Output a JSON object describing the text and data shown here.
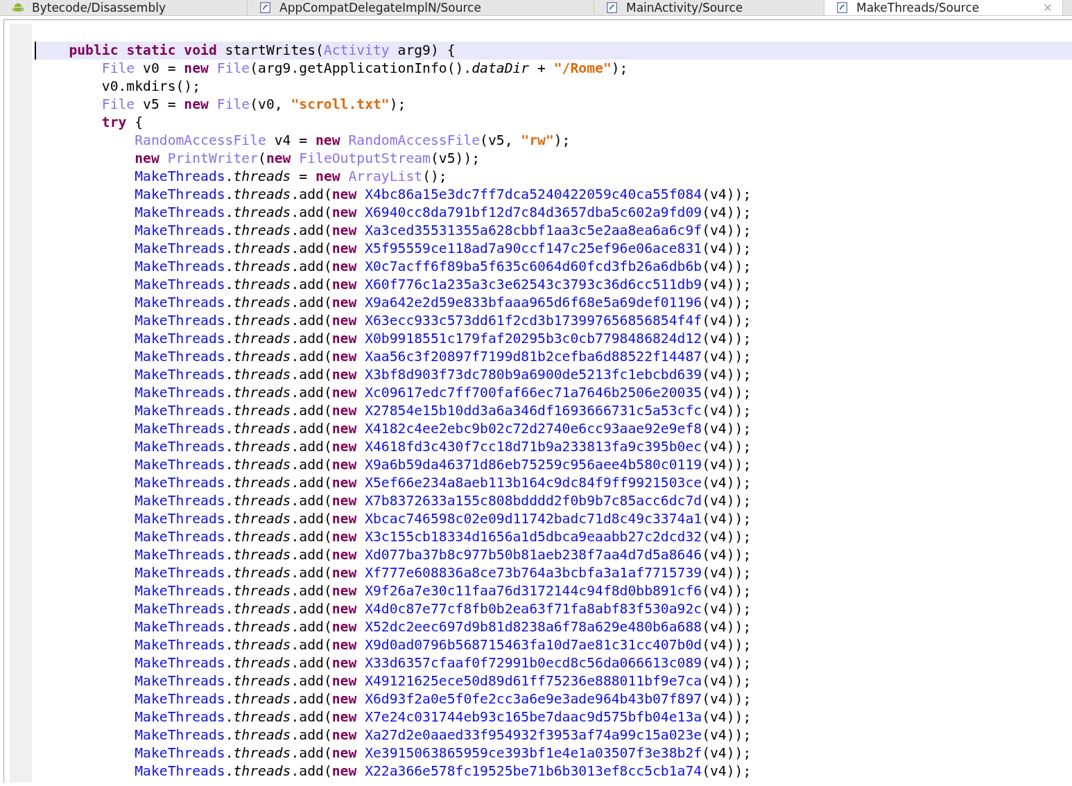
{
  "tabs": [
    {
      "label": "Bytecode/Disassembly",
      "kind": "android",
      "selected": false
    },
    {
      "label": "AppCompatDelegateImplN/Source",
      "kind": "java",
      "selected": false
    },
    {
      "label": "MainActivity/Source",
      "kind": "java",
      "selected": false
    },
    {
      "label": "MakeThreads/Source",
      "kind": "java",
      "selected": true
    }
  ],
  "code": [
    {
      "current": true,
      "tokens": [
        {
          "kind": "kw",
          "text": "public static void"
        },
        {
          "kind": "p",
          "text": " startWrites("
        },
        {
          "kind": "type",
          "text": "Activity"
        },
        {
          "kind": "p",
          "text": " arg9) {"
        }
      ],
      "children": [
        {
          "current": false,
          "tokens": [
            {
              "kind": "type",
              "text": "File"
            },
            {
              "kind": "p",
              "text": " v0 = "
            },
            {
              "kind": "kw",
              "text": "new"
            },
            {
              "kind": "type",
              "text": " File"
            },
            {
              "kind": "p",
              "text": "(arg9.getApplicationInfo()."
            },
            {
              "kind": "field",
              "text": "dataDir"
            },
            {
              "kind": "p",
              "text": " + "
            },
            {
              "kind": "str",
              "text": "\"/Rome\""
            },
            {
              "kind": "p",
              "text": ");"
            }
          ]
        },
        {
          "current": false,
          "tokens": [
            {
              "kind": "p",
              "text": "v0.mkdirs();"
            }
          ]
        },
        {
          "current": false,
          "tokens": [
            {
              "kind": "type",
              "text": "File"
            },
            {
              "kind": "p",
              "text": " v5 = "
            },
            {
              "kind": "kw",
              "text": "new"
            },
            {
              "kind": "type",
              "text": " File"
            },
            {
              "kind": "p",
              "text": "(v0, "
            },
            {
              "kind": "str",
              "text": "\"scroll.txt\""
            },
            {
              "kind": "p",
              "text": ");"
            }
          ]
        },
        {
          "current": false,
          "tokens": [
            {
              "kind": "kw",
              "text": "try"
            },
            {
              "kind": "p",
              "text": " {"
            }
          ],
          "children": [
            {
              "current": false,
              "tokens": [
                {
                  "kind": "type",
                  "text": "RandomAccessFile"
                },
                {
                  "kind": "p",
                  "text": " v4 = "
                },
                {
                  "kind": "kw",
                  "text": "new"
                },
                {
                  "kind": "type",
                  "text": " RandomAccessFile"
                },
                {
                  "kind": "p",
                  "text": "(v5, "
                },
                {
                  "kind": "str",
                  "text": "\"rw\""
                },
                {
                  "kind": "p",
                  "text": ");"
                }
              ]
            },
            {
              "current": false,
              "tokens": [
                {
                  "kind": "kw",
                  "text": "new"
                },
                {
                  "kind": "type",
                  "text": " PrintWriter"
                },
                {
                  "kind": "p",
                  "text": "("
                },
                {
                  "kind": "kw",
                  "text": "new"
                },
                {
                  "kind": "type",
                  "text": " FileOutputStream"
                },
                {
                  "kind": "p",
                  "text": "(v5));"
                }
              ]
            },
            {
              "current": false,
              "tokens": [
                {
                  "kind": "cls",
                  "text": "MakeThreads"
                },
                {
                  "kind": "p",
                  "text": "."
                },
                {
                  "kind": "field",
                  "text": "threads"
                },
                {
                  "kind": "p",
                  "text": " = "
                },
                {
                  "kind": "kw",
                  "text": "new"
                },
                {
                  "kind": "type",
                  "text": " ArrayList"
                },
                {
                  "kind": "p",
                  "text": "();"
                }
              ]
            },
            {
              "current": false,
              "tokens": [
                {
                  "kind": "cls",
                  "text": "MakeThreads"
                },
                {
                  "kind": "p",
                  "text": "."
                },
                {
                  "kind": "field",
                  "text": "threads"
                },
                {
                  "kind": "p",
                  "text": ".add("
                },
                {
                  "kind": "kw",
                  "text": "new"
                },
                {
                  "kind": "cls",
                  "text": " X4bc86a15e3dc7ff7dca5240422059c40ca55f084"
                },
                {
                  "kind": "p",
                  "text": "(v4));"
                }
              ]
            },
            {
              "current": false,
              "tokens": [
                {
                  "kind": "cls",
                  "text": "MakeThreads"
                },
                {
                  "kind": "p",
                  "text": "."
                },
                {
                  "kind": "field",
                  "text": "threads"
                },
                {
                  "kind": "p",
                  "text": ".add("
                },
                {
                  "kind": "kw",
                  "text": "new"
                },
                {
                  "kind": "cls",
                  "text": " X6940cc8da791bf12d7c84d3657dba5c602a9fd09"
                },
                {
                  "kind": "p",
                  "text": "(v4));"
                }
              ]
            },
            {
              "current": false,
              "tokens": [
                {
                  "kind": "cls",
                  "text": "MakeThreads"
                },
                {
                  "kind": "p",
                  "text": "."
                },
                {
                  "kind": "field",
                  "text": "threads"
                },
                {
                  "kind": "p",
                  "text": ".add("
                },
                {
                  "kind": "kw",
                  "text": "new"
                },
                {
                  "kind": "cls",
                  "text": " Xa3ced35531355a628cbbf1aa3c5e2aa8ea6a6c9f"
                },
                {
                  "kind": "p",
                  "text": "(v4));"
                }
              ]
            },
            {
              "current": false,
              "tokens": [
                {
                  "kind": "cls",
                  "text": "MakeThreads"
                },
                {
                  "kind": "p",
                  "text": "."
                },
                {
                  "kind": "field",
                  "text": "threads"
                },
                {
                  "kind": "p",
                  "text": ".add("
                },
                {
                  "kind": "kw",
                  "text": "new"
                },
                {
                  "kind": "cls",
                  "text": " X5f95559ce118ad7a90ccf147c25ef96e06ace831"
                },
                {
                  "kind": "p",
                  "text": "(v4));"
                }
              ]
            },
            {
              "current": false,
              "tokens": [
                {
                  "kind": "cls",
                  "text": "MakeThreads"
                },
                {
                  "kind": "p",
                  "text": "."
                },
                {
                  "kind": "field",
                  "text": "threads"
                },
                {
                  "kind": "p",
                  "text": ".add("
                },
                {
                  "kind": "kw",
                  "text": "new"
                },
                {
                  "kind": "cls",
                  "text": " X0c7acff6f89ba5f635c6064d60fcd3fb26a6db6b"
                },
                {
                  "kind": "p",
                  "text": "(v4));"
                }
              ]
            },
            {
              "current": false,
              "tokens": [
                {
                  "kind": "cls",
                  "text": "MakeThreads"
                },
                {
                  "kind": "p",
                  "text": "."
                },
                {
                  "kind": "field",
                  "text": "threads"
                },
                {
                  "kind": "p",
                  "text": ".add("
                },
                {
                  "kind": "kw",
                  "text": "new"
                },
                {
                  "kind": "cls",
                  "text": " X60f776c1a235a3c3e62543c3793c36d6cc511db9"
                },
                {
                  "kind": "p",
                  "text": "(v4));"
                }
              ]
            },
            {
              "current": false,
              "tokens": [
                {
                  "kind": "cls",
                  "text": "MakeThreads"
                },
                {
                  "kind": "p",
                  "text": "."
                },
                {
                  "kind": "field",
                  "text": "threads"
                },
                {
                  "kind": "p",
                  "text": ".add("
                },
                {
                  "kind": "kw",
                  "text": "new"
                },
                {
                  "kind": "cls",
                  "text": " X9a642e2d59e833bfaaa965d6f68e5a69def01196"
                },
                {
                  "kind": "p",
                  "text": "(v4));"
                }
              ]
            },
            {
              "current": false,
              "tokens": [
                {
                  "kind": "cls",
                  "text": "MakeThreads"
                },
                {
                  "kind": "p",
                  "text": "."
                },
                {
                  "kind": "field",
                  "text": "threads"
                },
                {
                  "kind": "p",
                  "text": ".add("
                },
                {
                  "kind": "kw",
                  "text": "new"
                },
                {
                  "kind": "cls",
                  "text": " X63ecc933c573dd61f2cd3b173997656856854f4f"
                },
                {
                  "kind": "p",
                  "text": "(v4));"
                }
              ]
            },
            {
              "current": false,
              "tokens": [
                {
                  "kind": "cls",
                  "text": "MakeThreads"
                },
                {
                  "kind": "p",
                  "text": "."
                },
                {
                  "kind": "field",
                  "text": "threads"
                },
                {
                  "kind": "p",
                  "text": ".add("
                },
                {
                  "kind": "kw",
                  "text": "new"
                },
                {
                  "kind": "cls",
                  "text": " X0b9918551c179faf20295b3c0cb7798486824d12"
                },
                {
                  "kind": "p",
                  "text": "(v4));"
                }
              ]
            },
            {
              "current": false,
              "tokens": [
                {
                  "kind": "cls",
                  "text": "MakeThreads"
                },
                {
                  "kind": "p",
                  "text": "."
                },
                {
                  "kind": "field",
                  "text": "threads"
                },
                {
                  "kind": "p",
                  "text": ".add("
                },
                {
                  "kind": "kw",
                  "text": "new"
                },
                {
                  "kind": "cls",
                  "text": " Xaa56c3f20897f7199d81b2cefba6d88522f14487"
                },
                {
                  "kind": "p",
                  "text": "(v4));"
                }
              ]
            },
            {
              "current": false,
              "tokens": [
                {
                  "kind": "cls",
                  "text": "MakeThreads"
                },
                {
                  "kind": "p",
                  "text": "."
                },
                {
                  "kind": "field",
                  "text": "threads"
                },
                {
                  "kind": "p",
                  "text": ".add("
                },
                {
                  "kind": "kw",
                  "text": "new"
                },
                {
                  "kind": "cls",
                  "text": " X3bf8d903f73dc780b9a6900de5213fc1ebcbd639"
                },
                {
                  "kind": "p",
                  "text": "(v4));"
                }
              ]
            },
            {
              "current": false,
              "tokens": [
                {
                  "kind": "cls",
                  "text": "MakeThreads"
                },
                {
                  "kind": "p",
                  "text": "."
                },
                {
                  "kind": "field",
                  "text": "threads"
                },
                {
                  "kind": "p",
                  "text": ".add("
                },
                {
                  "kind": "kw",
                  "text": "new"
                },
                {
                  "kind": "cls",
                  "text": " Xc09617edc7ff700faf66ec71a7646b2506e20035"
                },
                {
                  "kind": "p",
                  "text": "(v4));"
                }
              ]
            },
            {
              "current": false,
              "tokens": [
                {
                  "kind": "cls",
                  "text": "MakeThreads"
                },
                {
                  "kind": "p",
                  "text": "."
                },
                {
                  "kind": "field",
                  "text": "threads"
                },
                {
                  "kind": "p",
                  "text": ".add("
                },
                {
                  "kind": "kw",
                  "text": "new"
                },
                {
                  "kind": "cls",
                  "text": " X27854e15b10dd3a6a346df1693666731c5a53cfc"
                },
                {
                  "kind": "p",
                  "text": "(v4));"
                }
              ]
            },
            {
              "current": false,
              "tokens": [
                {
                  "kind": "cls",
                  "text": "MakeThreads"
                },
                {
                  "kind": "p",
                  "text": "."
                },
                {
                  "kind": "field",
                  "text": "threads"
                },
                {
                  "kind": "p",
                  "text": ".add("
                },
                {
                  "kind": "kw",
                  "text": "new"
                },
                {
                  "kind": "cls",
                  "text": " X4182c4ee2ebc9b02c72d2740e6cc93aae92e9ef8"
                },
                {
                  "kind": "p",
                  "text": "(v4));"
                }
              ]
            },
            {
              "current": false,
              "tokens": [
                {
                  "kind": "cls",
                  "text": "MakeThreads"
                },
                {
                  "kind": "p",
                  "text": "."
                },
                {
                  "kind": "field",
                  "text": "threads"
                },
                {
                  "kind": "p",
                  "text": ".add("
                },
                {
                  "kind": "kw",
                  "text": "new"
                },
                {
                  "kind": "cls",
                  "text": " X4618fd3c430f7cc18d71b9a233813fa9c395b0ec"
                },
                {
                  "kind": "p",
                  "text": "(v4));"
                }
              ]
            },
            {
              "current": false,
              "tokens": [
                {
                  "kind": "cls",
                  "text": "MakeThreads"
                },
                {
                  "kind": "p",
                  "text": "."
                },
                {
                  "kind": "field",
                  "text": "threads"
                },
                {
                  "kind": "p",
                  "text": ".add("
                },
                {
                  "kind": "kw",
                  "text": "new"
                },
                {
                  "kind": "cls",
                  "text": " X9a6b59da46371d86eb75259c956aee4b580c0119"
                },
                {
                  "kind": "p",
                  "text": "(v4));"
                }
              ]
            },
            {
              "current": false,
              "tokens": [
                {
                  "kind": "cls",
                  "text": "MakeThreads"
                },
                {
                  "kind": "p",
                  "text": "."
                },
                {
                  "kind": "field",
                  "text": "threads"
                },
                {
                  "kind": "p",
                  "text": ".add("
                },
                {
                  "kind": "kw",
                  "text": "new"
                },
                {
                  "kind": "cls",
                  "text": " X5ef66e234a8aeb113b164c9dc84f9ff9921503ce"
                },
                {
                  "kind": "p",
                  "text": "(v4));"
                }
              ]
            },
            {
              "current": false,
              "tokens": [
                {
                  "kind": "cls",
                  "text": "MakeThreads"
                },
                {
                  "kind": "p",
                  "text": "."
                },
                {
                  "kind": "field",
                  "text": "threads"
                },
                {
                  "kind": "p",
                  "text": ".add("
                },
                {
                  "kind": "kw",
                  "text": "new"
                },
                {
                  "kind": "cls",
                  "text": " X7b8372633a155c808bdddd2f0b9b7c85acc6dc7d"
                },
                {
                  "kind": "p",
                  "text": "(v4));"
                }
              ]
            },
            {
              "current": false,
              "tokens": [
                {
                  "kind": "cls",
                  "text": "MakeThreads"
                },
                {
                  "kind": "p",
                  "text": "."
                },
                {
                  "kind": "field",
                  "text": "threads"
                },
                {
                  "kind": "p",
                  "text": ".add("
                },
                {
                  "kind": "kw",
                  "text": "new"
                },
                {
                  "kind": "cls",
                  "text": " Xbcac746598c02e09d11742badc71d8c49c3374a1"
                },
                {
                  "kind": "p",
                  "text": "(v4));"
                }
              ]
            },
            {
              "current": false,
              "tokens": [
                {
                  "kind": "cls",
                  "text": "MakeThreads"
                },
                {
                  "kind": "p",
                  "text": "."
                },
                {
                  "kind": "field",
                  "text": "threads"
                },
                {
                  "kind": "p",
                  "text": ".add("
                },
                {
                  "kind": "kw",
                  "text": "new"
                },
                {
                  "kind": "cls",
                  "text": " X3c155cb18334d1656a1d5dbca9eaabb27c2dcd32"
                },
                {
                  "kind": "p",
                  "text": "(v4));"
                }
              ]
            },
            {
              "current": false,
              "tokens": [
                {
                  "kind": "cls",
                  "text": "MakeThreads"
                },
                {
                  "kind": "p",
                  "text": "."
                },
                {
                  "kind": "field",
                  "text": "threads"
                },
                {
                  "kind": "p",
                  "text": ".add("
                },
                {
                  "kind": "kw",
                  "text": "new"
                },
                {
                  "kind": "cls",
                  "text": " Xd077ba37b8c977b50b81aeb238f7aa4d7d5a8646"
                },
                {
                  "kind": "p",
                  "text": "(v4));"
                }
              ]
            },
            {
              "current": false,
              "tokens": [
                {
                  "kind": "cls",
                  "text": "MakeThreads"
                },
                {
                  "kind": "p",
                  "text": "."
                },
                {
                  "kind": "field",
                  "text": "threads"
                },
                {
                  "kind": "p",
                  "text": ".add("
                },
                {
                  "kind": "kw",
                  "text": "new"
                },
                {
                  "kind": "cls",
                  "text": " Xf777e608836a8ce73b764a3bcbfa3a1af7715739"
                },
                {
                  "kind": "p",
                  "text": "(v4));"
                }
              ]
            },
            {
              "current": false,
              "tokens": [
                {
                  "kind": "cls",
                  "text": "MakeThreads"
                },
                {
                  "kind": "p",
                  "text": "."
                },
                {
                  "kind": "field",
                  "text": "threads"
                },
                {
                  "kind": "p",
                  "text": ".add("
                },
                {
                  "kind": "kw",
                  "text": "new"
                },
                {
                  "kind": "cls",
                  "text": " X9f26a7e30c11faa76d3172144c94f8d0bb891cf6"
                },
                {
                  "kind": "p",
                  "text": "(v4));"
                }
              ]
            },
            {
              "current": false,
              "tokens": [
                {
                  "kind": "cls",
                  "text": "MakeThreads"
                },
                {
                  "kind": "p",
                  "text": "."
                },
                {
                  "kind": "field",
                  "text": "threads"
                },
                {
                  "kind": "p",
                  "text": ".add("
                },
                {
                  "kind": "kw",
                  "text": "new"
                },
                {
                  "kind": "cls",
                  "text": " X4d0c87e77cf8fb0b2ea63f71fa8abf83f530a92c"
                },
                {
                  "kind": "p",
                  "text": "(v4));"
                }
              ]
            },
            {
              "current": false,
              "tokens": [
                {
                  "kind": "cls",
                  "text": "MakeThreads"
                },
                {
                  "kind": "p",
                  "text": "."
                },
                {
                  "kind": "field",
                  "text": "threads"
                },
                {
                  "kind": "p",
                  "text": ".add("
                },
                {
                  "kind": "kw",
                  "text": "new"
                },
                {
                  "kind": "cls",
                  "text": " X52dc2eec697d9b81d8238a6f78a629e480b6a688"
                },
                {
                  "kind": "p",
                  "text": "(v4));"
                }
              ]
            },
            {
              "current": false,
              "tokens": [
                {
                  "kind": "cls",
                  "text": "MakeThreads"
                },
                {
                  "kind": "p",
                  "text": "."
                },
                {
                  "kind": "field",
                  "text": "threads"
                },
                {
                  "kind": "p",
                  "text": ".add("
                },
                {
                  "kind": "kw",
                  "text": "new"
                },
                {
                  "kind": "cls",
                  "text": " X9d0ad0796b568715463fa10d7ae81c31cc407b0d"
                },
                {
                  "kind": "p",
                  "text": "(v4));"
                }
              ]
            },
            {
              "current": false,
              "tokens": [
                {
                  "kind": "cls",
                  "text": "MakeThreads"
                },
                {
                  "kind": "p",
                  "text": "."
                },
                {
                  "kind": "field",
                  "text": "threads"
                },
                {
                  "kind": "p",
                  "text": ".add("
                },
                {
                  "kind": "kw",
                  "text": "new"
                },
                {
                  "kind": "cls",
                  "text": " X33d6357cfaaf0f72991b0ecd8c56da066613c089"
                },
                {
                  "kind": "p",
                  "text": "(v4));"
                }
              ]
            },
            {
              "current": false,
              "tokens": [
                {
                  "kind": "cls",
                  "text": "MakeThreads"
                },
                {
                  "kind": "p",
                  "text": "."
                },
                {
                  "kind": "field",
                  "text": "threads"
                },
                {
                  "kind": "p",
                  "text": ".add("
                },
                {
                  "kind": "kw",
                  "text": "new"
                },
                {
                  "kind": "cls",
                  "text": " X49121625ece50d89d61ff75236e888011bf9e7ca"
                },
                {
                  "kind": "p",
                  "text": "(v4));"
                }
              ]
            },
            {
              "current": false,
              "tokens": [
                {
                  "kind": "cls",
                  "text": "MakeThreads"
                },
                {
                  "kind": "p",
                  "text": "."
                },
                {
                  "kind": "field",
                  "text": "threads"
                },
                {
                  "kind": "p",
                  "text": ".add("
                },
                {
                  "kind": "kw",
                  "text": "new"
                },
                {
                  "kind": "cls",
                  "text": " X6d93f2a0e5f0fe2cc3a6e9e3ade964b43b07f897"
                },
                {
                  "kind": "p",
                  "text": "(v4));"
                }
              ]
            },
            {
              "current": false,
              "tokens": [
                {
                  "kind": "cls",
                  "text": "MakeThreads"
                },
                {
                  "kind": "p",
                  "text": "."
                },
                {
                  "kind": "field",
                  "text": "threads"
                },
                {
                  "kind": "p",
                  "text": ".add("
                },
                {
                  "kind": "kw",
                  "text": "new"
                },
                {
                  "kind": "cls",
                  "text": " X7e24c031744eb93c165be7daac9d575bfb04e13a"
                },
                {
                  "kind": "p",
                  "text": "(v4));"
                }
              ]
            },
            {
              "current": false,
              "tokens": [
                {
                  "kind": "cls",
                  "text": "MakeThreads"
                },
                {
                  "kind": "p",
                  "text": "."
                },
                {
                  "kind": "field",
                  "text": "threads"
                },
                {
                  "kind": "p",
                  "text": ".add("
                },
                {
                  "kind": "kw",
                  "text": "new"
                },
                {
                  "kind": "cls",
                  "text": " Xa27d2e0aaed33f954932f3953af74a99c15a023e"
                },
                {
                  "kind": "p",
                  "text": "(v4));"
                }
              ]
            },
            {
              "current": false,
              "tokens": [
                {
                  "kind": "cls",
                  "text": "MakeThreads"
                },
                {
                  "kind": "p",
                  "text": "."
                },
                {
                  "kind": "field",
                  "text": "threads"
                },
                {
                  "kind": "p",
                  "text": ".add("
                },
                {
                  "kind": "kw",
                  "text": "new"
                },
                {
                  "kind": "cls",
                  "text": " Xe3915063865959ce393bf1e4e1a03507f3e38b2f"
                },
                {
                  "kind": "p",
                  "text": "(v4));"
                }
              ]
            },
            {
              "current": false,
              "tokens": [
                {
                  "kind": "cls",
                  "text": "MakeThreads"
                },
                {
                  "kind": "p",
                  "text": "."
                },
                {
                  "kind": "field",
                  "text": "threads"
                },
                {
                  "kind": "p",
                  "text": ".add("
                },
                {
                  "kind": "kw",
                  "text": "new"
                },
                {
                  "kind": "cls",
                  "text": " X22a366e578fc19525be71b6b3013ef8cc5cb1a74"
                },
                {
                  "kind": "p",
                  "text": "(v4));"
                }
              ]
            }
          ]
        }
      ]
    }
  ]
}
